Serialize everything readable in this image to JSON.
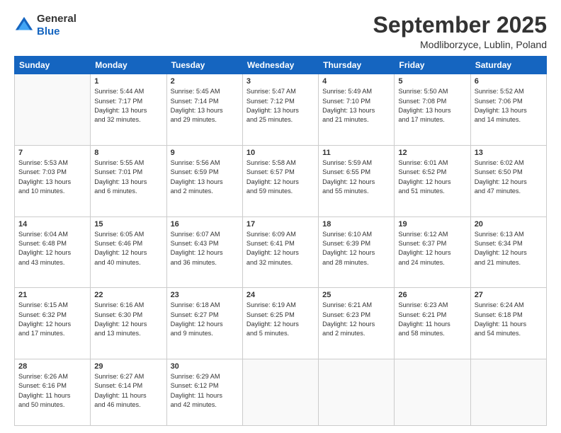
{
  "header": {
    "logo_general": "General",
    "logo_blue": "Blue",
    "month_title": "September 2025",
    "location": "Modliborzyce, Lublin, Poland"
  },
  "days_of_week": [
    "Sunday",
    "Monday",
    "Tuesday",
    "Wednesday",
    "Thursday",
    "Friday",
    "Saturday"
  ],
  "weeks": [
    [
      {
        "day": "",
        "info": ""
      },
      {
        "day": "1",
        "info": "Sunrise: 5:44 AM\nSunset: 7:17 PM\nDaylight: 13 hours\nand 32 minutes."
      },
      {
        "day": "2",
        "info": "Sunrise: 5:45 AM\nSunset: 7:14 PM\nDaylight: 13 hours\nand 29 minutes."
      },
      {
        "day": "3",
        "info": "Sunrise: 5:47 AM\nSunset: 7:12 PM\nDaylight: 13 hours\nand 25 minutes."
      },
      {
        "day": "4",
        "info": "Sunrise: 5:49 AM\nSunset: 7:10 PM\nDaylight: 13 hours\nand 21 minutes."
      },
      {
        "day": "5",
        "info": "Sunrise: 5:50 AM\nSunset: 7:08 PM\nDaylight: 13 hours\nand 17 minutes."
      },
      {
        "day": "6",
        "info": "Sunrise: 5:52 AM\nSunset: 7:06 PM\nDaylight: 13 hours\nand 14 minutes."
      }
    ],
    [
      {
        "day": "7",
        "info": "Sunrise: 5:53 AM\nSunset: 7:03 PM\nDaylight: 13 hours\nand 10 minutes."
      },
      {
        "day": "8",
        "info": "Sunrise: 5:55 AM\nSunset: 7:01 PM\nDaylight: 13 hours\nand 6 minutes."
      },
      {
        "day": "9",
        "info": "Sunrise: 5:56 AM\nSunset: 6:59 PM\nDaylight: 13 hours\nand 2 minutes."
      },
      {
        "day": "10",
        "info": "Sunrise: 5:58 AM\nSunset: 6:57 PM\nDaylight: 12 hours\nand 59 minutes."
      },
      {
        "day": "11",
        "info": "Sunrise: 5:59 AM\nSunset: 6:55 PM\nDaylight: 12 hours\nand 55 minutes."
      },
      {
        "day": "12",
        "info": "Sunrise: 6:01 AM\nSunset: 6:52 PM\nDaylight: 12 hours\nand 51 minutes."
      },
      {
        "day": "13",
        "info": "Sunrise: 6:02 AM\nSunset: 6:50 PM\nDaylight: 12 hours\nand 47 minutes."
      }
    ],
    [
      {
        "day": "14",
        "info": "Sunrise: 6:04 AM\nSunset: 6:48 PM\nDaylight: 12 hours\nand 43 minutes."
      },
      {
        "day": "15",
        "info": "Sunrise: 6:05 AM\nSunset: 6:46 PM\nDaylight: 12 hours\nand 40 minutes."
      },
      {
        "day": "16",
        "info": "Sunrise: 6:07 AM\nSunset: 6:43 PM\nDaylight: 12 hours\nand 36 minutes."
      },
      {
        "day": "17",
        "info": "Sunrise: 6:09 AM\nSunset: 6:41 PM\nDaylight: 12 hours\nand 32 minutes."
      },
      {
        "day": "18",
        "info": "Sunrise: 6:10 AM\nSunset: 6:39 PM\nDaylight: 12 hours\nand 28 minutes."
      },
      {
        "day": "19",
        "info": "Sunrise: 6:12 AM\nSunset: 6:37 PM\nDaylight: 12 hours\nand 24 minutes."
      },
      {
        "day": "20",
        "info": "Sunrise: 6:13 AM\nSunset: 6:34 PM\nDaylight: 12 hours\nand 21 minutes."
      }
    ],
    [
      {
        "day": "21",
        "info": "Sunrise: 6:15 AM\nSunset: 6:32 PM\nDaylight: 12 hours\nand 17 minutes."
      },
      {
        "day": "22",
        "info": "Sunrise: 6:16 AM\nSunset: 6:30 PM\nDaylight: 12 hours\nand 13 minutes."
      },
      {
        "day": "23",
        "info": "Sunrise: 6:18 AM\nSunset: 6:27 PM\nDaylight: 12 hours\nand 9 minutes."
      },
      {
        "day": "24",
        "info": "Sunrise: 6:19 AM\nSunset: 6:25 PM\nDaylight: 12 hours\nand 5 minutes."
      },
      {
        "day": "25",
        "info": "Sunrise: 6:21 AM\nSunset: 6:23 PM\nDaylight: 12 hours\nand 2 minutes."
      },
      {
        "day": "26",
        "info": "Sunrise: 6:23 AM\nSunset: 6:21 PM\nDaylight: 11 hours\nand 58 minutes."
      },
      {
        "day": "27",
        "info": "Sunrise: 6:24 AM\nSunset: 6:18 PM\nDaylight: 11 hours\nand 54 minutes."
      }
    ],
    [
      {
        "day": "28",
        "info": "Sunrise: 6:26 AM\nSunset: 6:16 PM\nDaylight: 11 hours\nand 50 minutes."
      },
      {
        "day": "29",
        "info": "Sunrise: 6:27 AM\nSunset: 6:14 PM\nDaylight: 11 hours\nand 46 minutes."
      },
      {
        "day": "30",
        "info": "Sunrise: 6:29 AM\nSunset: 6:12 PM\nDaylight: 11 hours\nand 42 minutes."
      },
      {
        "day": "",
        "info": ""
      },
      {
        "day": "",
        "info": ""
      },
      {
        "day": "",
        "info": ""
      },
      {
        "day": "",
        "info": ""
      }
    ]
  ]
}
